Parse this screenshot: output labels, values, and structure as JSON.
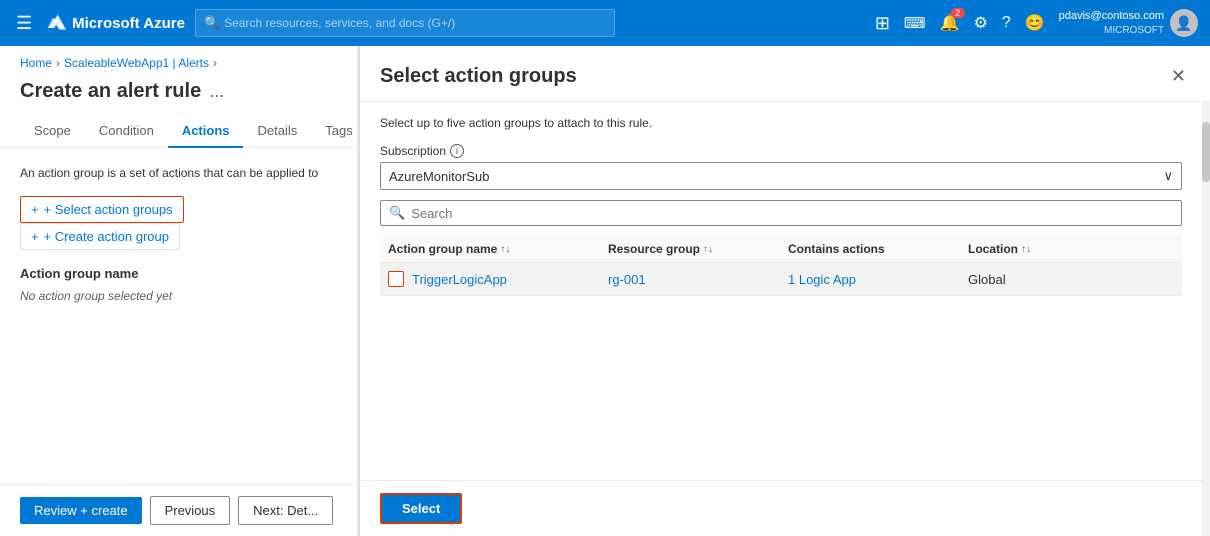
{
  "topnav": {
    "hamburger": "☰",
    "logo_text": "Microsoft Azure",
    "search_placeholder": "Search resources, services, and docs (G+/)",
    "notification_count": "2",
    "user_email": "pdavis@contoso.com",
    "user_company": "MICROSOFT"
  },
  "breadcrumb": {
    "home": "Home",
    "app": "ScaleableWebApp1 | Alerts"
  },
  "page": {
    "title": "Create an alert rule",
    "menu_icon": "..."
  },
  "tabs": [
    {
      "label": "Scope",
      "active": false
    },
    {
      "label": "Condition",
      "active": false
    },
    {
      "label": "Actions",
      "active": true
    },
    {
      "label": "Details",
      "active": false
    },
    {
      "label": "Tags",
      "active": false
    }
  ],
  "panel": {
    "info_text": "An action group is a set of actions that can be applied to",
    "select_action_btn": "+ Select action groups",
    "create_action_btn": "+ Create action group",
    "section_header": "Action group name",
    "no_selection_text": "No action group selected yet"
  },
  "bottom_bar": {
    "review_btn": "Review + create",
    "previous_btn": "Previous",
    "next_btn": "Next: Det...",
    "select_btn": "Select"
  },
  "dialog": {
    "title": "Select action groups",
    "subtitle": "Select up to five action groups to attach to this rule.",
    "subscription_label": "Subscription",
    "subscription_info": "i",
    "subscription_value": "AzureMonitorSub",
    "search_placeholder": "Search",
    "table": {
      "columns": [
        {
          "label": "Action group name",
          "sort": "↑↓"
        },
        {
          "label": "Resource group",
          "sort": "↑↓"
        },
        {
          "label": "Contains actions",
          "sort": ""
        },
        {
          "label": "Location",
          "sort": "↑↓"
        }
      ],
      "rows": [
        {
          "checked": true,
          "name": "TriggerLogicApp",
          "resource_group": "rg-001",
          "contains_actions": "1 Logic App",
          "location": "Global"
        }
      ]
    }
  }
}
